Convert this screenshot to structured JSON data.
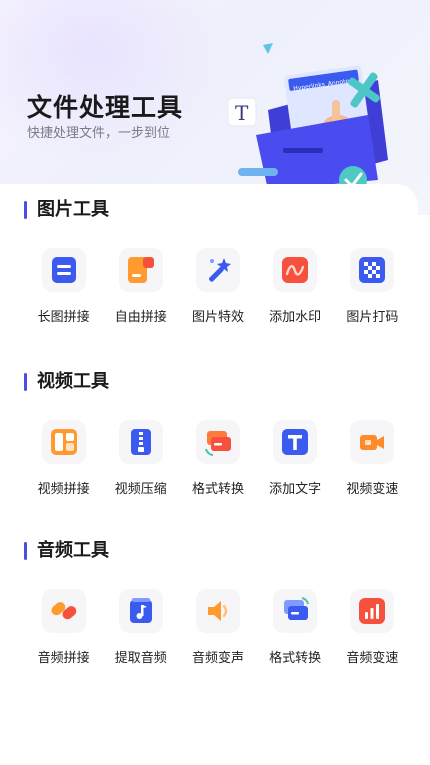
{
  "header": {
    "title": "文件处理工具",
    "subtitle": "快捷处理文件，一步到位",
    "illustration_doc_text": "Hyperlinks_Annotes",
    "illustration_letter": "T"
  },
  "sections": [
    {
      "title": "图片工具",
      "tools": [
        {
          "label": "长图拼接",
          "icon": "long-image-stitch-icon"
        },
        {
          "label": "自由拼接",
          "icon": "free-stitch-icon"
        },
        {
          "label": "图片特效",
          "icon": "magic-wand-icon"
        },
        {
          "label": "添加水印",
          "icon": "watermark-icon"
        },
        {
          "label": "图片打码",
          "icon": "mosaic-icon"
        }
      ]
    },
    {
      "title": "视频工具",
      "tools": [
        {
          "label": "视频拼接",
          "icon": "video-stitch-icon"
        },
        {
          "label": "视频压缩",
          "icon": "zip-compress-icon"
        },
        {
          "label": "格式转换",
          "icon": "format-convert-icon"
        },
        {
          "label": "添加文字",
          "icon": "text-T-icon"
        },
        {
          "label": "视频变速",
          "icon": "video-camera-icon"
        }
      ]
    },
    {
      "title": "音频工具",
      "tools": [
        {
          "label": "音频拼接",
          "icon": "audio-stitch-icon"
        },
        {
          "label": "提取音频",
          "icon": "music-note-icon"
        },
        {
          "label": "音频变声",
          "icon": "speaker-icon"
        },
        {
          "label": "格式转换",
          "icon": "format-convert-icon"
        },
        {
          "label": "音频变速",
          "icon": "bar-chart-icon"
        }
      ]
    }
  ],
  "colors": {
    "accent": "#4b4ee0",
    "blue": "#3b5bf0",
    "orange": "#ff8a2a",
    "red": "#f5513c"
  }
}
